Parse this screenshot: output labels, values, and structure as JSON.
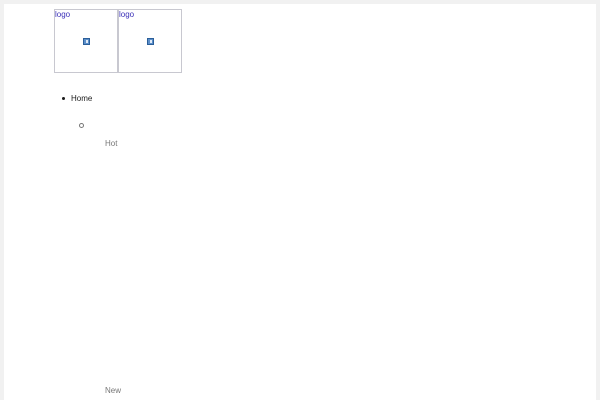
{
  "logos": [
    {
      "alt_text": "logo",
      "icon": "broken-image-icon"
    },
    {
      "alt_text": "logo",
      "icon": "broken-image-icon"
    }
  ],
  "nav": {
    "home_label": "Home",
    "submenu": {
      "hot_label": "Hot",
      "new_label": "New"
    }
  },
  "colors": {
    "alt_text": "#3a2fb8",
    "primary_text": "#1b1b1b",
    "muted_text": "#777777",
    "page_background": "#ffffff",
    "outer_background": "#f1f1f1"
  }
}
